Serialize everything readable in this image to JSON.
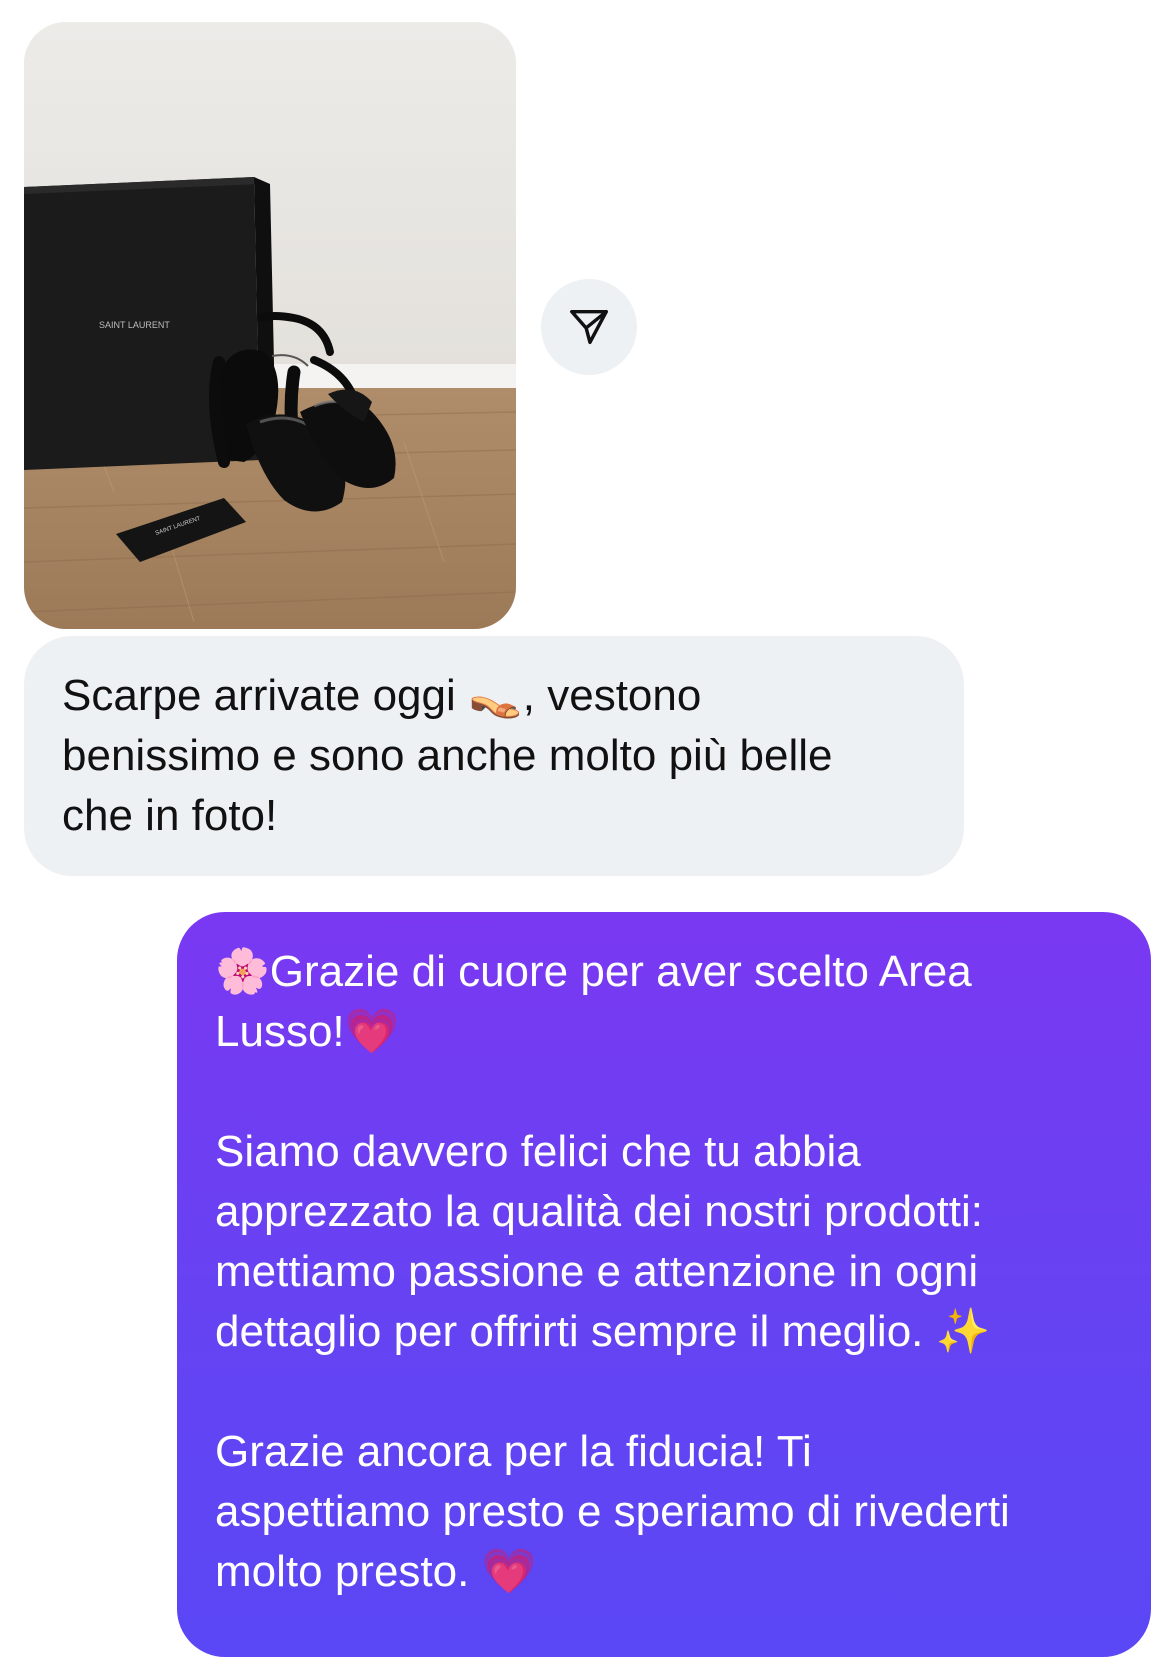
{
  "thread": {
    "photo_message": {
      "image": "saint-laurent-sandals-photo",
      "box_logo_text": "SAINT LAURENT",
      "card_logo_text": "SAINT LAURENT"
    },
    "share_action": {
      "icon": "send-paper-plane-icon"
    },
    "received_message": {
      "text": "Scarpe arrivate oggi 👡, vestono\nbenissimo e sono anche molto più belle\nche in foto!"
    },
    "sent_message": {
      "paragraphs": [
        "🌸Grazie di cuore per aver scelto Area\nLusso!💗",
        "Siamo davvero felici che tu abbia\napprezzato la qualità dei nostri prodotti:\nmettiamo passione e attenzione in ogni\ndettaglio per offrirti sempre il meglio. ✨",
        "Grazie ancora per la fiducia! Ti\naspettiamo presto e speriamo di rivederti\nmolto presto. 💗"
      ]
    }
  },
  "colors": {
    "received_bubble": "#eef1f4",
    "sent_bubble_top": "#7a38f2",
    "sent_bubble_bottom": "#5a47f5",
    "sent_text": "#ffffff",
    "received_text": "#111111"
  }
}
